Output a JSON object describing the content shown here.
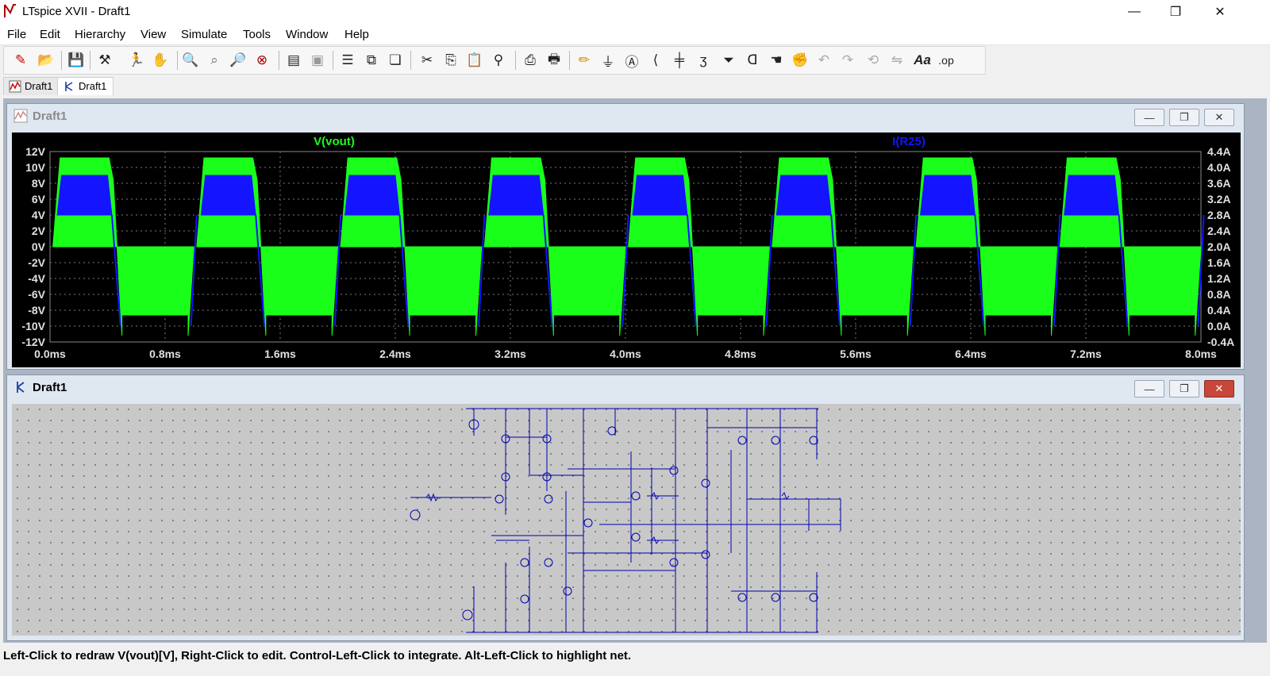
{
  "window": {
    "title": "LTspice XVII - Draft1"
  },
  "menu": [
    "File",
    "Edit",
    "Hierarchy",
    "View",
    "Simulate",
    "Tools",
    "Window",
    "Help"
  ],
  "toolbar_icons": [
    "new-schematic-icon",
    "open-icon",
    "save-icon",
    "control-panel-icon",
    "run-icon",
    "halt-icon",
    "zoom-in-icon",
    "zoom-pan-icon",
    "zoom-out-icon",
    "zoom-cancel-icon",
    "autorange-icon",
    "fit-view-icon",
    "tile-horizontal-icon",
    "tile-vertical-icon",
    "cascade-icon",
    "cut-icon",
    "copy-icon",
    "paste-icon",
    "find-icon",
    "print-preview-icon",
    "print-icon",
    "draw-wire-icon",
    "ground-icon",
    "label-net-icon",
    "resistor-icon",
    "capacitor-icon",
    "inductor-icon",
    "diode-icon",
    "component-icon",
    "move-icon",
    "drag-icon",
    "undo-icon",
    "redo-icon",
    "rotate-icon",
    "mirror-icon",
    "text-icon",
    "spice-directive-icon"
  ],
  "tabs": [
    {
      "label": "Draft1",
      "icon": "waveform-tab-icon"
    },
    {
      "label": "Draft1",
      "icon": "schematic-tab-icon"
    }
  ],
  "waveform_window": {
    "title": "Draft1"
  },
  "schematic_window": {
    "title": "Draft1"
  },
  "chart_data": {
    "type": "line",
    "series": [
      {
        "name": "V(vout)",
        "color": "#1aff1a",
        "axis": "left"
      },
      {
        "name": "I(R25)",
        "color": "#1414ff",
        "axis": "right"
      }
    ],
    "x_ticks": [
      "0.0ms",
      "0.8ms",
      "1.6ms",
      "2.4ms",
      "3.2ms",
      "4.0ms",
      "4.8ms",
      "5.6ms",
      "6.4ms",
      "7.2ms",
      "8.0ms"
    ],
    "y_left_ticks": [
      "12V",
      "10V",
      "8V",
      "6V",
      "4V",
      "2V",
      "0V",
      "-2V",
      "-4V",
      "-6V",
      "-8V",
      "-10V",
      "-12V"
    ],
    "y_right_ticks": [
      "4.4A",
      "4.0A",
      "3.6A",
      "3.2A",
      "2.8A",
      "2.4A",
      "2.0A",
      "1.6A",
      "1.2A",
      "0.8A",
      "0.4A",
      "0.0A",
      "-0.4A"
    ],
    "xlim": [
      0,
      8.0
    ],
    "ylim_left": [
      -12,
      12
    ],
    "ylim_right": [
      -0.4,
      4.4
    ],
    "period_ms": 1.0,
    "vout_high_band": [
      8.4,
      11.2
    ],
    "vout_low_band": [
      -11.2,
      -8.6
    ],
    "ir25_high_band": [
      2.8,
      3.8
    ],
    "ir25_low": 0.0,
    "grid": true
  },
  "status": {
    "text": "Left-Click to redraw V(vout)[V],  Right-Click to edit. Control-Left-Click to integrate. Alt-Left-Click to highlight net."
  }
}
